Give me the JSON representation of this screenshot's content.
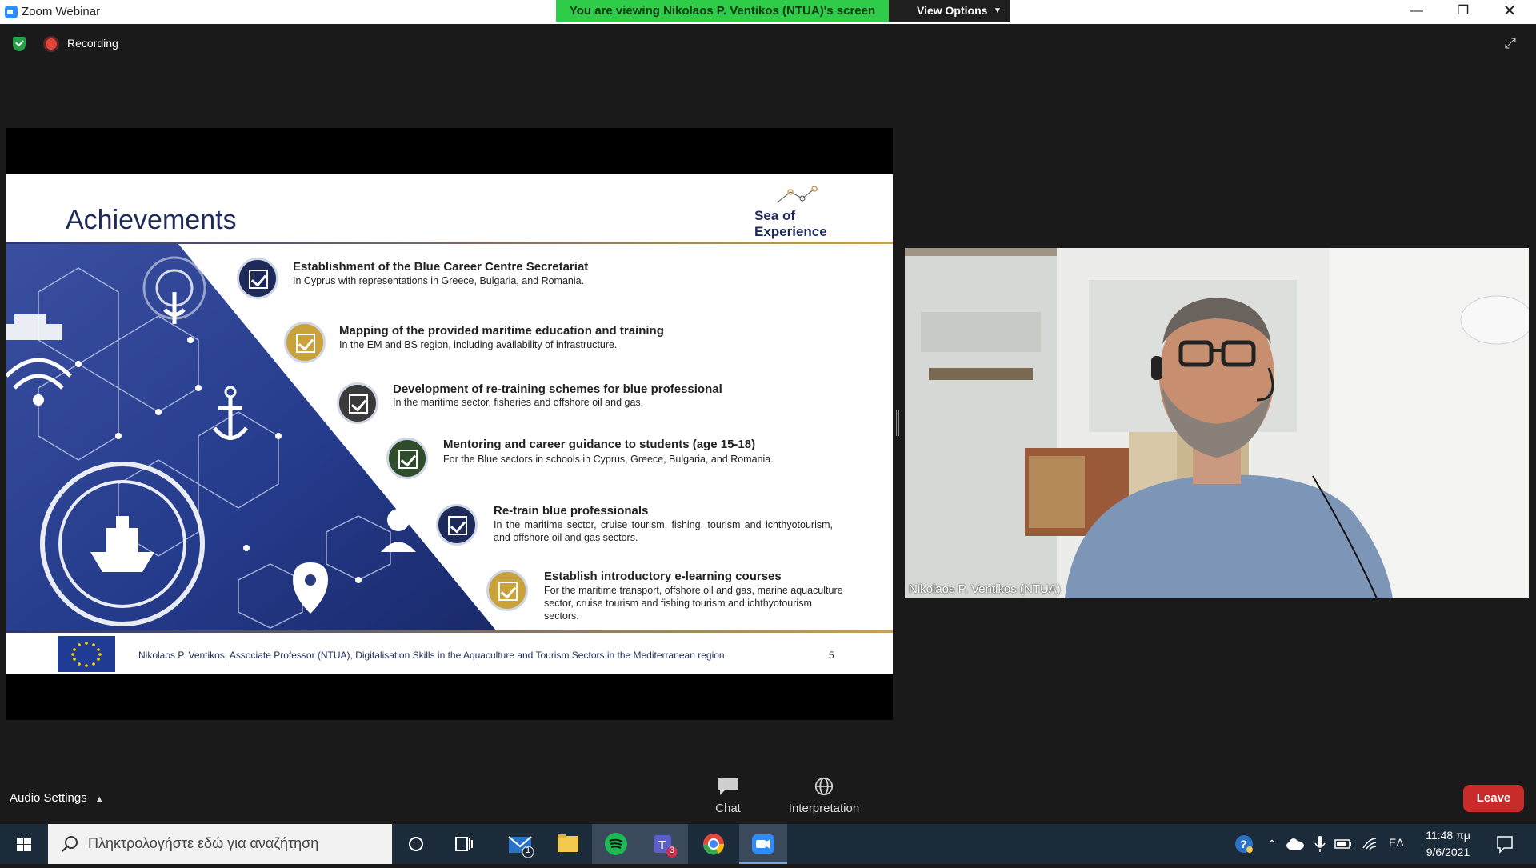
{
  "window": {
    "title": "Zoom Webinar",
    "viewing_banner": "You are viewing Nikolaos P. Ventikos (NTUA)'s screen",
    "view_options": "View Options",
    "minimize_icon": "minimize-icon",
    "restore_icon": "restore-icon",
    "close_icon": "close-icon"
  },
  "status": {
    "recording_label": "Recording",
    "shield_color": "#24a148",
    "recording_color": "#e0443a"
  },
  "slide": {
    "title": "Achievements",
    "logo_text_line1": "Sea",
    "logo_text_of": "of",
    "logo_text_line2": "Experience",
    "items": [
      {
        "title": "Establishment of the Blue Career Centre Secretariat",
        "desc": "In Cyprus with representations in Greece, Bulgaria, and Romania.",
        "color": "#1e2a5a"
      },
      {
        "title": "Mapping of the provided maritime education and training",
        "desc": "In the EM and BS region, including availability of infrastructure.",
        "color": "#c9a23c"
      },
      {
        "title": "Development of re-training schemes for blue professional",
        "desc": "In the maritime sector, fisheries and offshore oil and gas.",
        "color": "#3a3a3a"
      },
      {
        "title": "Mentoring and career guidance to students (age 15-18)",
        "desc": "For the Blue sectors in schools in Cyprus, Greece, Bulgaria, and Romania.",
        "color": "#2f4d2a"
      },
      {
        "title": "Re-train blue professionals",
        "desc": "In the maritime sector, cruise tourism, fishing, tourism and ichthyotourism, and offshore oil and gas sectors.",
        "color": "#1e2a5a"
      },
      {
        "title": "Establish introductory e-learning courses",
        "desc": "For the maritime transport, offshore oil and gas, marine aquaculture sector, cruise tourism and fishing tourism and ichthyotourism sectors.",
        "color": "#c9a23c"
      }
    ],
    "footer_text": "Nikolaos P. Ventikos, Associate Professor (NTUA), Digitalisation Skills in the Aquaculture and Tourism Sectors in the Mediterranean region",
    "page_number": "5"
  },
  "video": {
    "participant_name": "Nikolaos P. Ventikos (NTUA)"
  },
  "toolbar": {
    "audio_settings": "Audio Settings",
    "chat": "Chat",
    "interpretation": "Interpretation",
    "leave": "Leave"
  },
  "taskbar": {
    "search_placeholder": "Πληκτρολογήστε εδώ για αναζήτηση",
    "mail_badge": "1",
    "teams_badge": "3",
    "language": "ΕΛ",
    "time": "11:48 πμ",
    "date": "9/6/2021",
    "apps": [
      "cortana-icon",
      "task-view-icon",
      "mail-icon",
      "file-explorer-icon",
      "spotify-icon",
      "teams-icon",
      "chrome-icon",
      "zoom-icon"
    ]
  }
}
